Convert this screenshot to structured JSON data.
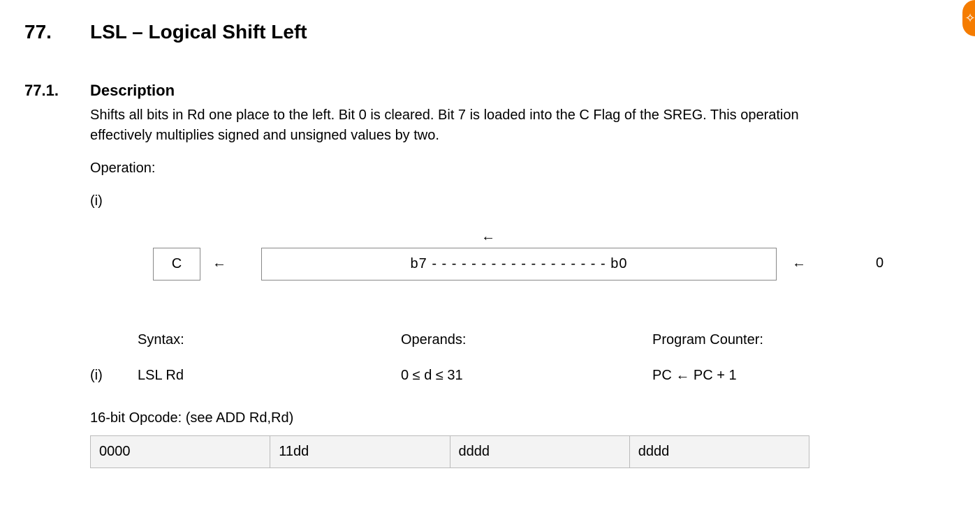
{
  "heading": {
    "number": "77.",
    "title": "LSL – Logical Shift Left"
  },
  "subheading": {
    "number": "77.1.",
    "title": "Description"
  },
  "description_text": "Shifts all bits in Rd one place to the left. Bit 0 is cleared. Bit 7 is loaded into the C Flag of the SREG. This operation effectively multiplies signed and unsigned values by two.",
  "operation_label": "Operation:",
  "operation_index": "(i)",
  "diagram": {
    "top_arrow": "←",
    "c_box": "C",
    "arrow1": "←",
    "reg": "b7 - - - - - - - - - - - - - - - - - - b0",
    "arrow2": "←",
    "zero": "0"
  },
  "syntax_table": {
    "headers": {
      "syntax": "Syntax:",
      "operands": "Operands:",
      "pc": "Program Counter:"
    },
    "row_index": "(i)",
    "syntax": "LSL Rd",
    "operands": "0 ≤ d ≤ 31",
    "pc": "PC ← PC + 1"
  },
  "opcode_label": "16-bit Opcode: (see ADD Rd,Rd)",
  "opcode": [
    "0000",
    "11dd",
    "dddd",
    "dddd"
  ]
}
